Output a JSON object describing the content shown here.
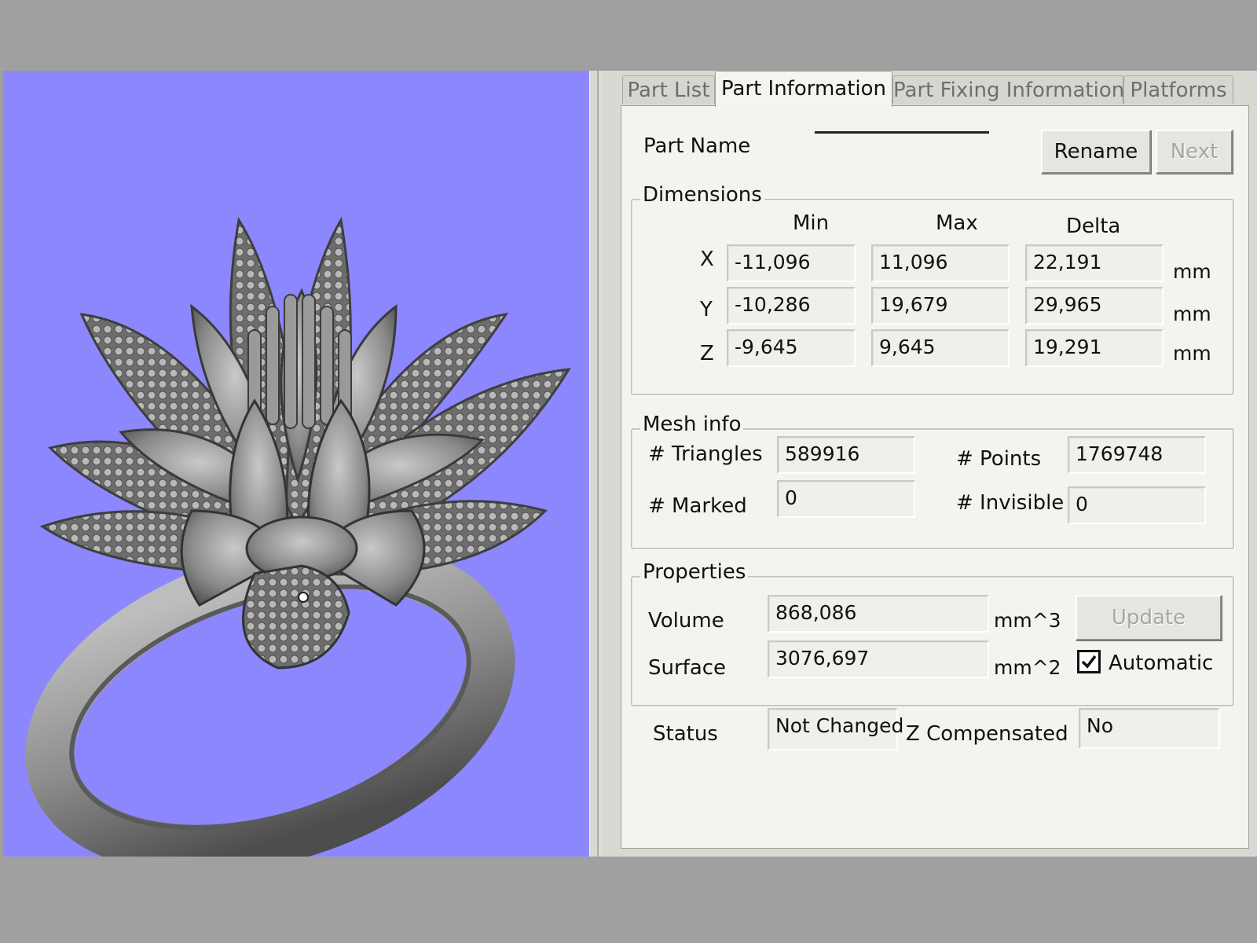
{
  "tabs": [
    {
      "label": "Part List"
    },
    {
      "label": "Part Information"
    },
    {
      "label": "Part Fixing Information"
    },
    {
      "label": "Platforms"
    }
  ],
  "part": {
    "name_label": "Part Name",
    "name_value": "",
    "rename_label": "Rename",
    "next_label": "Next"
  },
  "dimensions": {
    "title": "Dimensions",
    "col_min": "Min",
    "col_max": "Max",
    "col_delta": "Delta",
    "rows": [
      {
        "axis": "X",
        "min": "-11,096",
        "max": "11,096",
        "delta": "22,191",
        "unit": "mm"
      },
      {
        "axis": "Y",
        "min": "-10,286",
        "max": "19,679",
        "delta": "29,965",
        "unit": "mm"
      },
      {
        "axis": "Z",
        "min": "-9,645",
        "max": "9,645",
        "delta": "19,291",
        "unit": "mm"
      }
    ]
  },
  "mesh": {
    "title": "Mesh info",
    "triangles_label": "# Triangles",
    "triangles": "589916",
    "points_label": "# Points",
    "points": "1769748",
    "marked_label": "# Marked",
    "marked": "0",
    "invisible_label": "# Invisible",
    "invisible": "0"
  },
  "properties": {
    "title": "Properties",
    "volume_label": "Volume",
    "volume": "868,086",
    "volume_unit": "mm^3",
    "surface_label": "Surface",
    "surface": "3076,697",
    "surface_unit": "mm^2",
    "update_label": "Update",
    "automatic_label": "Automatic",
    "automatic_checked": true
  },
  "status": {
    "status_label": "Status",
    "status_value": "Not Changed",
    "zcomp_label": "Z Compensated",
    "zcomp_value": "No"
  },
  "colors": {
    "viewport_bg": "#8c87fc",
    "panel_bg": "#d9d9d3"
  }
}
